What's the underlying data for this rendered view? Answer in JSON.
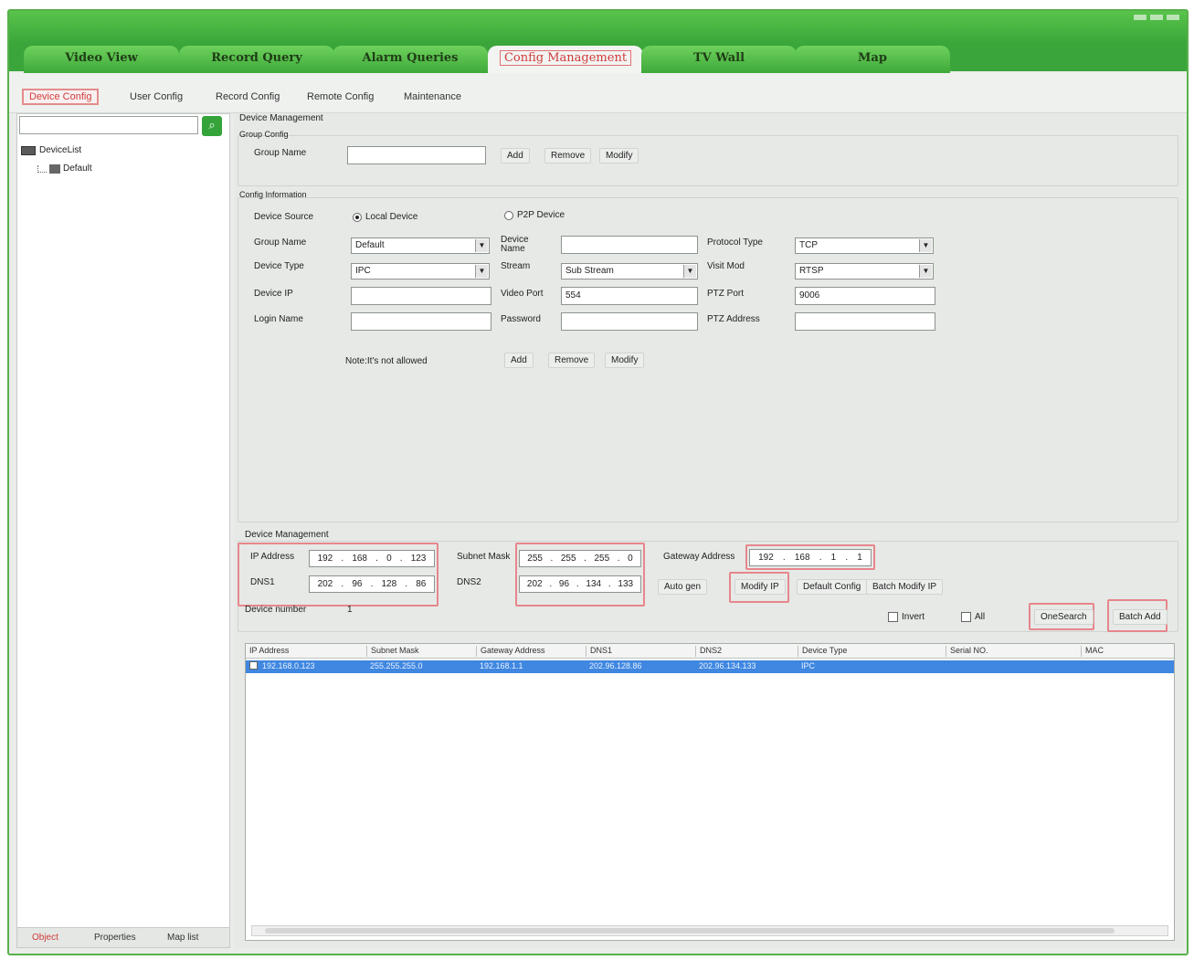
{
  "main_tabs": [
    "Video View",
    "Record Query",
    "Alarm Queries",
    "Config Management",
    "TV Wall",
    "Map"
  ],
  "sub_tabs": [
    "Device Config",
    "User Config",
    "Record Config",
    "Remote Config",
    "Maintenance"
  ],
  "left": {
    "tree_root": "DeviceList",
    "tree_child": "Default",
    "bottom_tabs": [
      "Object",
      "Properties",
      "Map list"
    ]
  },
  "group_config": {
    "section_title": "Device Management",
    "title": "Group Config",
    "group_name_label": "Group Name",
    "group_name_value": "",
    "buttons": [
      "Add",
      "Remove",
      "Modify"
    ]
  },
  "config_info": {
    "title": "Config Information",
    "device_source_label": "Device Source",
    "local_device": "Local Device",
    "p2p_device": "P2P Device",
    "group_name_label": "Group Name",
    "group_name_value": "Default",
    "device_type_label": "Device Type",
    "device_type_value": "IPC",
    "device_ip_label": "Device IP",
    "device_ip_value": "",
    "login_name_label": "Login Name",
    "login_name_value": "",
    "device_name_label": "Device Name",
    "device_name_value": "",
    "stream_label": "Stream",
    "stream_value": "Sub Stream",
    "video_port_label": "Video Port",
    "video_port_value": "554",
    "password_label": "Password",
    "password_value": "",
    "protocol_type_label": "Protocol Type",
    "protocol_type_value": "TCP",
    "visit_mod_label": "Visit Mod",
    "visit_mod_value": "RTSP",
    "ptz_port_label": "PTZ Port",
    "ptz_port_value": "9006",
    "ptz_address_label": "PTZ Address",
    "ptz_address_value": "",
    "note": "Note:It's not allowed",
    "buttons": [
      "Add",
      "Remove",
      "Modify"
    ]
  },
  "batch": {
    "title": "Device Management",
    "ip_address_label": "IP Address",
    "ip_address": [
      "192",
      "168",
      "0",
      "123"
    ],
    "subnet_mask_label": "Subnet Mask",
    "subnet_mask": [
      "255",
      "255",
      "255",
      "0"
    ],
    "gateway_label": "Gateway Address",
    "gateway": [
      "192",
      "168",
      "1",
      "1"
    ],
    "dns1_label": "DNS1",
    "dns1": [
      "202",
      "96",
      "128",
      "86"
    ],
    "dns2_label": "DNS2",
    "dns2": [
      "202",
      "96",
      "134",
      "133"
    ],
    "auto_gen": "Auto gen",
    "modify_ip": "Modify IP",
    "default_config": "Default Config",
    "batch_modify_ip": "Batch Modify IP",
    "device_number_label": "Device number",
    "device_number": "1",
    "invert": "Invert",
    "all": "All",
    "one_search": "OneSearch",
    "batch_add": "Batch Add"
  },
  "table": {
    "columns": [
      "IP Address",
      "Subnet Mask",
      "Gateway Address",
      "DNS1",
      "DNS2",
      "Device Type",
      "Serial NO.",
      "MAC"
    ],
    "rows": [
      [
        "192.168.0.123",
        "255.255.255.0",
        "192.168.1.1",
        "202.96.128.86",
        "202.96.134.133",
        "IPC",
        "",
        ""
      ]
    ]
  }
}
